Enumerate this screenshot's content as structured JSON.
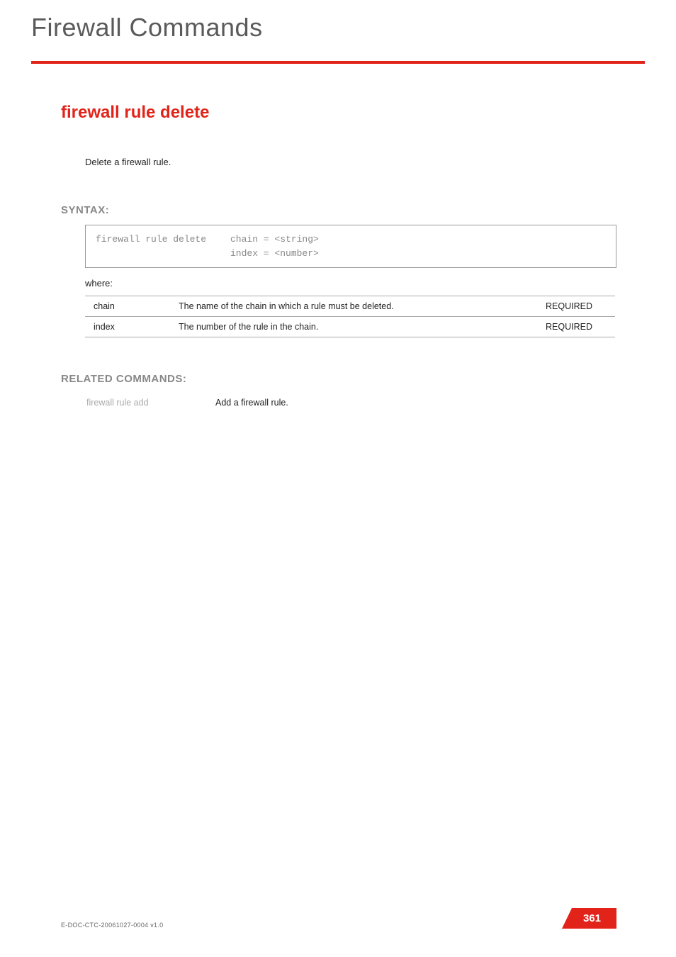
{
  "header": {
    "title": "Firewall Commands"
  },
  "command": {
    "title": "firewall rule delete",
    "intro": "Delete a firewall rule."
  },
  "syntax": {
    "heading": "SYNTAX:",
    "cmd": "firewall rule delete",
    "args_line1": "chain = <string>",
    "args_line2": "index = <number>",
    "where": "where:"
  },
  "params": [
    {
      "name": "chain",
      "desc": "The name of the chain in which a rule must be deleted.",
      "req": "REQUIRED"
    },
    {
      "name": "index",
      "desc": "The number of the rule in the chain.",
      "req": "REQUIRED"
    }
  ],
  "related": {
    "heading": "RELATED COMMANDS:",
    "items": [
      {
        "cmd": "firewall rule add",
        "desc": "Add a firewall rule."
      }
    ]
  },
  "footer": {
    "doc_id": "E-DOC-CTC-20061027-0004 v1.0",
    "page": "361"
  }
}
